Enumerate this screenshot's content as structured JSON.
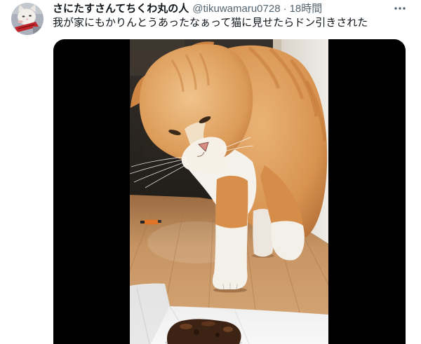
{
  "colors": {
    "text_primary": "#0f1419",
    "text_secondary": "#536471",
    "page_background": "#ffffff",
    "media_letterbox": "#000000"
  },
  "tweet": {
    "author_name": "さにたすさんてちくわ丸の人",
    "handle": "@tikuwamaru0728",
    "separator": "·",
    "timestamp": "18時間",
    "text": "我が家にもかりんとうあったなぁって猫に見せたらドン引きされた"
  },
  "more_button": {
    "icon": "more-horizontal-icon"
  }
}
